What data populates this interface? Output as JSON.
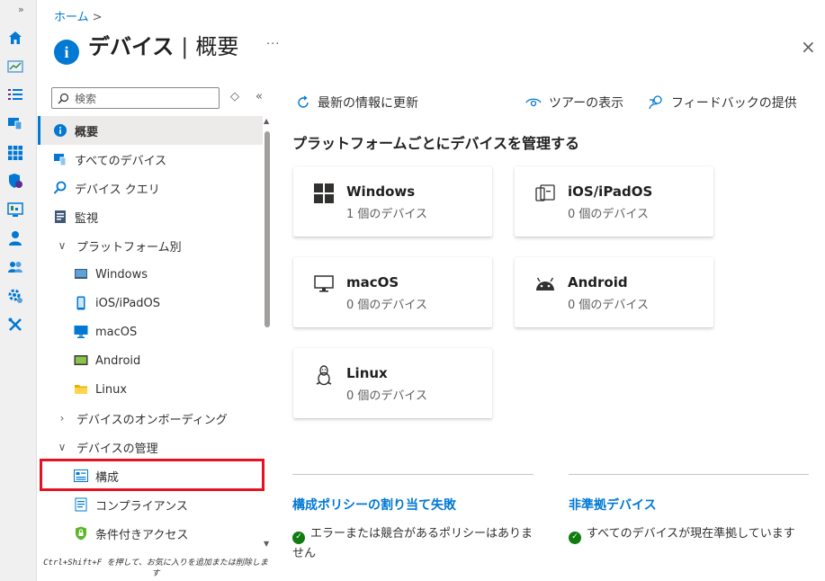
{
  "rail": {
    "expand_label": "»",
    "icons": [
      "home-icon",
      "dashboard-icon",
      "list-icon",
      "devices-icon",
      "apps-icon",
      "endpoint-security-icon",
      "reports-icon",
      "users-icon",
      "groups-icon",
      "tenant-admin-icon",
      "troubleshooting-icon"
    ]
  },
  "breadcrumb": {
    "home": "ホーム",
    "separator": ">"
  },
  "page": {
    "title": "デバイス",
    "separator": "|",
    "subtitle": "概要",
    "more": "···",
    "close": "×"
  },
  "nav": {
    "search_placeholder": "検索",
    "items": [
      {
        "label": "概要",
        "icon": "info-icon",
        "level": 0,
        "selected": true
      },
      {
        "label": "すべてのデバイス",
        "icon": "all-devices-icon",
        "level": 0
      },
      {
        "label": "デバイス クエリ",
        "icon": "device-query-icon",
        "level": 0
      },
      {
        "label": "監視",
        "icon": "monitor-icon",
        "level": 0
      },
      {
        "label": "プラットフォーム別",
        "chevron": "v",
        "level": 0
      },
      {
        "label": "Windows",
        "icon": "windows-icon",
        "level": 1
      },
      {
        "label": "iOS/iPadOS",
        "icon": "ios-icon",
        "level": 1
      },
      {
        "label": "macOS",
        "icon": "macos-icon",
        "level": 1
      },
      {
        "label": "Android",
        "icon": "android-icon",
        "level": 1
      },
      {
        "label": "Linux",
        "icon": "linux-icon",
        "level": 1
      },
      {
        "label": "デバイスのオンボーディング",
        "chevron": ">",
        "level": 0
      },
      {
        "label": "デバイスの管理",
        "chevron": "v",
        "level": 0
      },
      {
        "label": "構成",
        "icon": "configuration-icon",
        "level": 1
      },
      {
        "label": "コンプライアンス",
        "icon": "compliance-icon",
        "level": 1
      },
      {
        "label": "条件付きアクセス",
        "icon": "conditional-access-icon",
        "level": 1
      }
    ],
    "hint": "Ctrl+Shift+F を押して、お気に入りを追加または削除します"
  },
  "toolbar": {
    "refresh": "最新の情報に更新",
    "tour": "ツアーの表示",
    "feedback": "フィードバックの提供"
  },
  "section_title": "プラットフォームごとにデバイスを管理する",
  "cards": [
    {
      "name": "Windows",
      "count": "1 個のデバイス",
      "icon": "windows-icon"
    },
    {
      "name": "iOS/iPadOS",
      "count": "0 個のデバイス",
      "icon": "ios-icon"
    },
    {
      "name": "macOS",
      "count": "0 個のデバイス",
      "icon": "macos-icon"
    },
    {
      "name": "Android",
      "count": "0 個のデバイス",
      "icon": "android-icon"
    },
    {
      "name": "Linux",
      "count": "0 個のデバイス",
      "icon": "linux-icon"
    }
  ],
  "bottom": {
    "left": {
      "title": "構成ポリシーの割り当て失敗",
      "status": "エラーまたは競合があるポリシーはありません"
    },
    "right": {
      "title": "非準拠デバイス",
      "status": "すべてのデバイスが現在準拠しています"
    }
  },
  "colors": {
    "accent": "#0078d4",
    "success": "#107c10",
    "highlight": "#e81123"
  }
}
